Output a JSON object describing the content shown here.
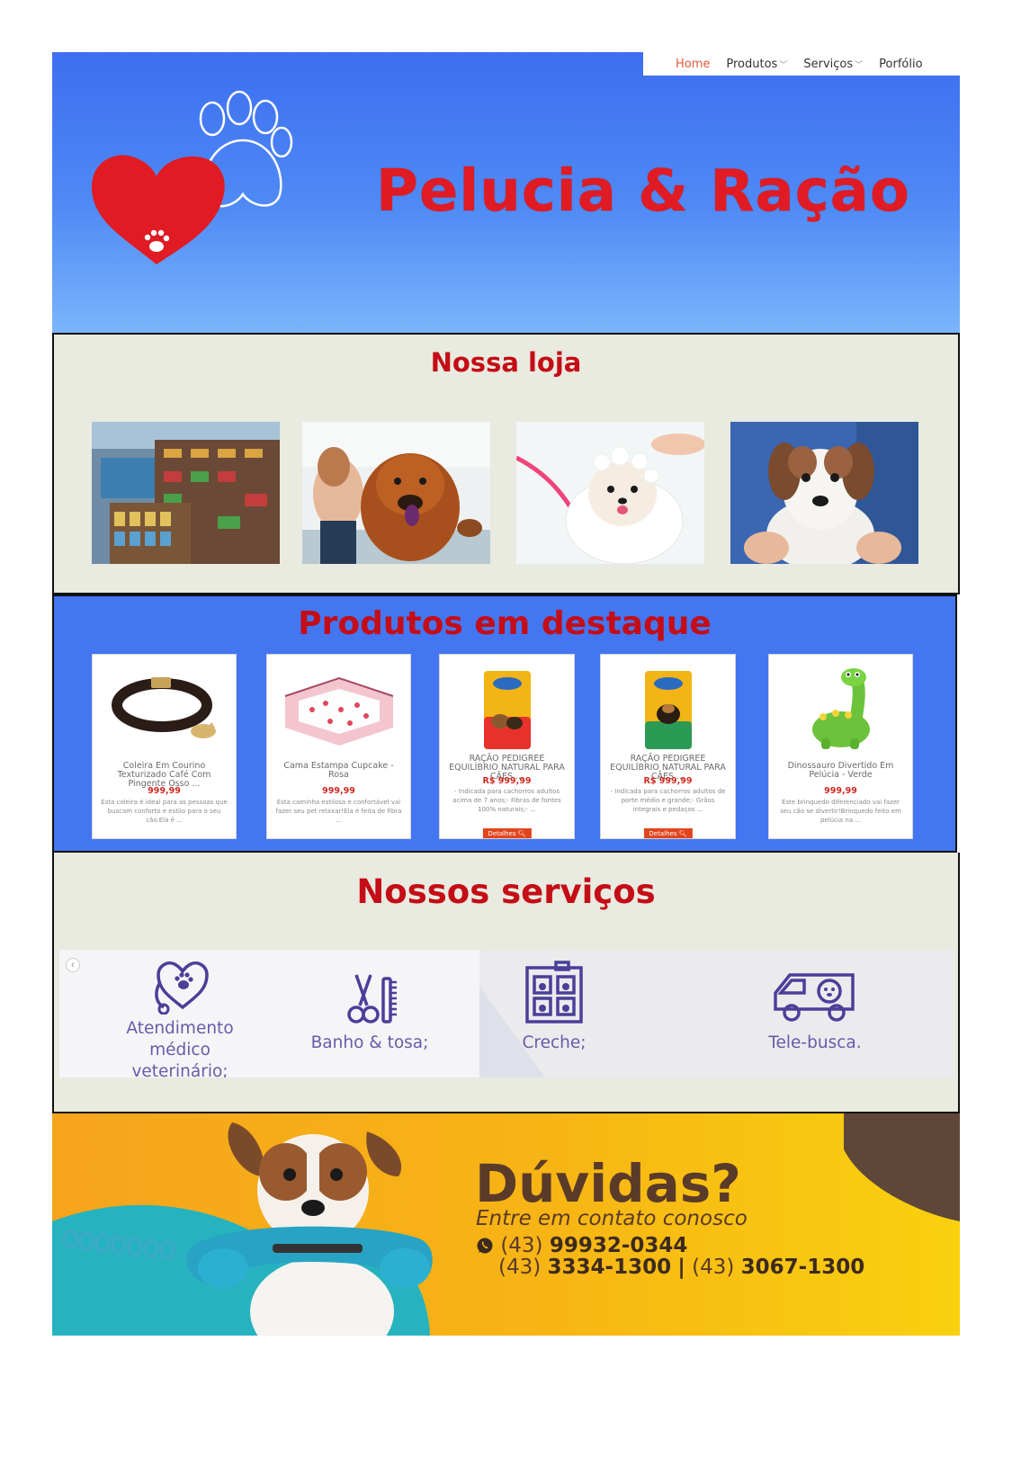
{
  "nav": {
    "items": [
      {
        "label": "Home",
        "has_dropdown": false,
        "active": true
      },
      {
        "label": "Produtos",
        "has_dropdown": true,
        "active": false
      },
      {
        "label": "Serviços",
        "has_dropdown": true,
        "active": false
      },
      {
        "label": "Porfólio",
        "has_dropdown": false,
        "active": false
      }
    ],
    "chevron": "⌄"
  },
  "hero": {
    "brand": "Pelucia & Ração",
    "logo_icons": [
      "heart-icon",
      "paw-icon"
    ]
  },
  "loja": {
    "title": "Nossa loja",
    "photos": [
      "pet-store-interior",
      "groomer-with-chow-chow",
      "dog-bath",
      "puppy-in-arms"
    ]
  },
  "produtos": {
    "title": "Produtos em destaque",
    "items": [
      {
        "name": "Coleira Em Courino Texturizado Café Com Pingente Osso ...",
        "price": "999,99",
        "desc": "Esta coleira é ideal para as pessoas que buscam conforto e estilo para o seu cão.Ela é ...",
        "button": ""
      },
      {
        "name": "Cama Estampa Cupcake - Rosa",
        "price": "999,99",
        "desc": "Esta caminha estilosa e confortável vai fazer seu pet relaxar!Ela é feita de fibra ...",
        "button": ""
      },
      {
        "name": "RAÇÃO PEDIGREE EQUILÍBRIO NATURAL PARA CÃES ...",
        "price": "R$ 999,99",
        "desc": "- Indicada para cachorros adultos acima de 7 anos;- Fibras de fontes 100% naturais;- ...",
        "button": "Detalhes"
      },
      {
        "name": "RAÇÃO PEDIGREE EQUILÍBRIO NATURAL PARA CÃES ...",
        "price": "R$ 999,99",
        "desc": "- Indicada para cachorros adultos de porte médio e grande;- Grãos integrais e pedaços ...",
        "button": "Detalhes"
      },
      {
        "name": "Dinossauro Divertido Em Pelúcia - Verde",
        "price": "999,99",
        "desc": "Este brinquedo diferenciado vai fazer seu cão se divertir!Brinquedo feito em pelúcia na ...",
        "button": ""
      }
    ]
  },
  "servicos": {
    "title": "Nossos serviços",
    "prev_arrow": "‹",
    "items": [
      {
        "line1": "Atendimento médico",
        "line2": "veterinário;",
        "icon": "stethoscope-paw-icon"
      },
      {
        "line1": "Banho & tosa;",
        "line2": "",
        "icon": "scissors-comb-icon"
      },
      {
        "line1": "Creche;",
        "line2": "",
        "icon": "daycare-building-icon"
      },
      {
        "line1": "Tele-busca.",
        "line2": "",
        "icon": "pet-van-icon"
      }
    ]
  },
  "contato": {
    "headline": "Dúvidas?",
    "sub": "Entre em contato conosco",
    "whatsapp_prefix": "(43)",
    "whatsapp_number": "99932-0344",
    "phone1_prefix": "(43)",
    "phone1_number": "3334-1300",
    "separator": "|",
    "phone2_prefix": "(43)",
    "phone2_number": "3067-1300"
  },
  "colors": {
    "brand_red": "#e01b24",
    "hero_blue": "#3d6ef0",
    "products_blue": "#4476f2",
    "section_bg": "#e9eae0",
    "service_purple": "#6a5aa8",
    "contact_yellow": "#f7b515",
    "contact_brown": "#5a3a28"
  }
}
